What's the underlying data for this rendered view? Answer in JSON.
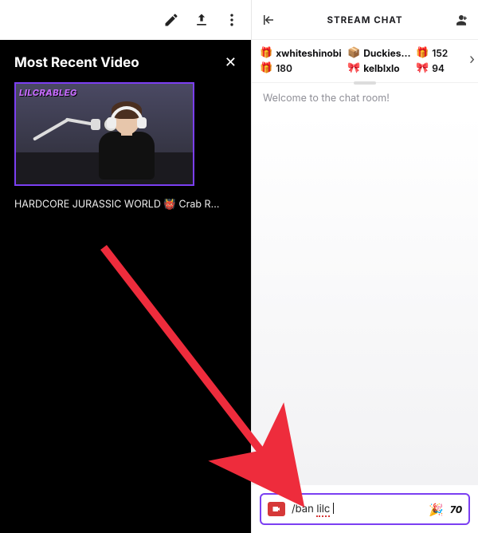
{
  "left": {
    "panel_title": "Most Recent Video",
    "close_glyph": "✕",
    "thumb_tag": "LILCRABLEG",
    "video_caption": "HARDCORE JURASSIC WORLD 👹 Crab R…"
  },
  "chat": {
    "header_title": "STREAM CHAT",
    "welcome": "Welcome to the chat room!",
    "input_command": "/ban",
    "input_arg": "lilc",
    "bits_label": "70"
  },
  "leaderboard": {
    "entries": [
      {
        "name": "xwhiteshinobi",
        "value": "180",
        "gift": "🎁"
      },
      {
        "name": "Duckies…",
        "value": "152",
        "gift": "📦"
      },
      {
        "name": "kelblxlo",
        "value": "94",
        "gift": "🎀"
      }
    ],
    "more_glyph": "›"
  },
  "icons": {
    "edit": "edit-icon",
    "share": "share-icon",
    "more": "more-vert-icon",
    "collapse": "collapse-arrow-icon",
    "community": "users-icon",
    "camera": "camera-icon",
    "emote": "party-popper-icon"
  }
}
